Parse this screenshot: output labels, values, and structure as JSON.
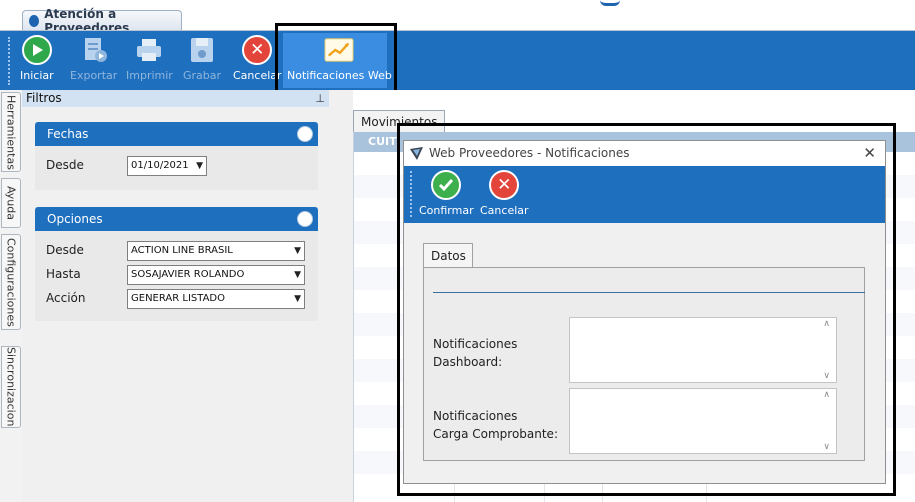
{
  "window": {
    "tab_title": "Atención a Proveedores"
  },
  "toolbar": {
    "iniciar": "Iniciar",
    "exportar": "Exportar",
    "imprimir": "Imprimir",
    "grabar": "Grabar",
    "cancelar": "Cancelar",
    "notificaciones_web": "Notificaciones Web"
  },
  "side_tabs": [
    "Herramientas",
    "Ayuda",
    "Configuraciones",
    "Sincronizacion"
  ],
  "filtros": {
    "title": "Filtros",
    "fechas": {
      "title": "Fechas",
      "desde_label": "Desde",
      "desde_value": "01/10/2021"
    },
    "opciones": {
      "title": "Opciones",
      "desde_label": "Desde",
      "desde_value": "ACTION LINE BRASIL",
      "hasta_label": "Hasta",
      "hasta_value": "SOSAJAVIER ROLANDO",
      "accion_label": "Acción",
      "accion_value": "GENERAR LISTADO"
    }
  },
  "movimientos": {
    "tab": "Movimientos",
    "first_column": "CUIT"
  },
  "dialog": {
    "title": "Web Proveedores - Notificaciones",
    "confirmar": "Confirmar",
    "cancelar": "Cancelar",
    "tab": "Datos",
    "dashboard_label_1": "Notificaciones",
    "dashboard_label_2": "Dashboard:",
    "carga_label_1": "Notificaciones",
    "carga_label_2": "Carga Comprobante:"
  },
  "colors": {
    "toolbar_blue": "#1f6fbf",
    "active_blue": "#3a8de0",
    "grid_header": "#a9c3dd"
  }
}
